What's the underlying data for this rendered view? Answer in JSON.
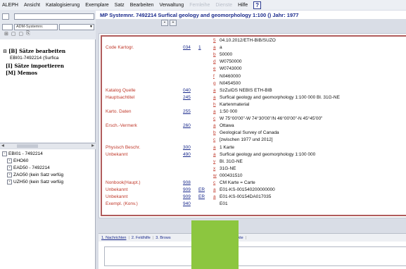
{
  "menu": {
    "items": [
      "ALEPH",
      "Ansicht",
      "Katalogisierung",
      "Exemplare",
      "Satz",
      "Bearbeiten",
      "Verwaltung"
    ],
    "disabled_items": [
      "Fernleihe",
      "Dienste"
    ],
    "help_label": "Hilfe",
    "help_icon_label": "?"
  },
  "toolbar": {
    "dropdown_small_value": "",
    "dropdown_left_value": "ADM-Systemnr.",
    "dropdown_right_value": "",
    "tree_icons": [
      "⊞",
      "▢",
      "▢",
      "⎘"
    ]
  },
  "left_top": {
    "group1": "[B] Sätze bearbeiten",
    "group1_item": "EBI01-7492214 (Surfica",
    "group2": "[I] Sätze importieren",
    "group3": "[M] Memos"
  },
  "left_bottom": {
    "root": "EBI01 - 7492214",
    "children": [
      "EHO60",
      "EAD50 - 7492214",
      "ZAO50 (kein Satz verfüg",
      "UZH50 (kein Satz verfüg"
    ]
  },
  "title": {
    "text": "MP Systemnr. 7492214 Surfical geology and geomorphology 1:100 () Jahr: 1977"
  },
  "record": {
    "rows": [
      {
        "label": "",
        "tag": "",
        "ind": "",
        "sub": "5",
        "value": "04.10.2012/ETH-BIB/SUZO"
      },
      {
        "label": "Code Kartogr.",
        "tag": "034",
        "ind": "1",
        "sub": "a",
        "value": "a"
      },
      {
        "label": "",
        "tag": "",
        "ind": "",
        "sub": "b",
        "value": "50000"
      },
      {
        "label": "",
        "tag": "",
        "ind": "",
        "sub": "d",
        "value": "W0750000"
      },
      {
        "label": "",
        "tag": "",
        "ind": "",
        "sub": "e",
        "value": "W0743000"
      },
      {
        "label": "",
        "tag": "",
        "ind": "",
        "sub": "f",
        "value": "N0460000"
      },
      {
        "label": "",
        "tag": "",
        "ind": "",
        "sub": "g",
        "value": "N0454500"
      },
      {
        "label": "Katalog Quelle",
        "tag": "040",
        "ind": "",
        "sub": "a",
        "value": "SzZuIDS NEBIS ETH-BIB"
      },
      {
        "label": "Hauptsachtitel",
        "tag": "245",
        "ind": "",
        "sub": "a",
        "value": "Surfical geology and geomorphology 1:100 000 Bl. 31G-NE"
      },
      {
        "label": "",
        "tag": "",
        "ind": "",
        "sub": "h",
        "value": "Kartenmaterial"
      },
      {
        "label": "Karto. Daten",
        "tag": "255",
        "ind": "",
        "sub": "a",
        "value": "1:50 000"
      },
      {
        "label": "",
        "tag": "",
        "ind": "",
        "sub": "c",
        "value": "W 75°00'00\"-W 74°30'00\"/N 46°00'00\"-N 45°45'00\""
      },
      {
        "label": "Ersch.-Vermerk",
        "tag": "260",
        "ind": "",
        "sub": "a",
        "value": "Ottawa"
      },
      {
        "label": "",
        "tag": "",
        "ind": "",
        "sub": "b",
        "value": "Geological Survey of Canada"
      },
      {
        "label": "",
        "tag": "",
        "ind": "",
        "sub": "c",
        "value": "[zwischen 1977 und 2012]"
      },
      {
        "label": "Physisch Beschr.",
        "tag": "300",
        "ind": "",
        "sub": "a",
        "value": "1 Karte"
      },
      {
        "label": "Unbekannt",
        "tag": "490",
        "ind": "",
        "sub": "a",
        "value": "Surfical geology and geomorphology 1:100 000"
      },
      {
        "label": "",
        "tag": "",
        "ind": "",
        "sub": "v",
        "value": "Bl. 31G-NE"
      },
      {
        "label": "",
        "tag": "",
        "ind": "",
        "sub": "x",
        "value": "31G-NE"
      },
      {
        "label": "",
        "tag": "",
        "ind": "",
        "sub": "w",
        "value": "000431510"
      },
      {
        "label": "Nonbook(Haupt.)",
        "tag": "908",
        "ind": "",
        "sub": "c",
        "value": "CM Karte = Carte"
      },
      {
        "label": "Unbekannt",
        "tag": "909",
        "ind": "ER",
        "sub": "a",
        "value": "E01-KS-001540200000000"
      },
      {
        "label": "Unbekannt",
        "tag": "909",
        "ind": "ER",
        "sub": "a",
        "value": "E01-KS-00154DA017035"
      },
      {
        "label": "Exempl. (Konv.)",
        "tag": "940",
        "ind": "",
        "sub": "",
        "value": "E01"
      }
    ]
  },
  "tabs": [
    "1. Nachrichten",
    "2. Feldhilfe",
    "3. Brows",
    "5. Objekte"
  ],
  "colors": {
    "label_red": "#c0392b",
    "link_blue": "#1a2a8c",
    "frame_red": "#b05c5c",
    "overlay_green": "#8cc63f"
  }
}
